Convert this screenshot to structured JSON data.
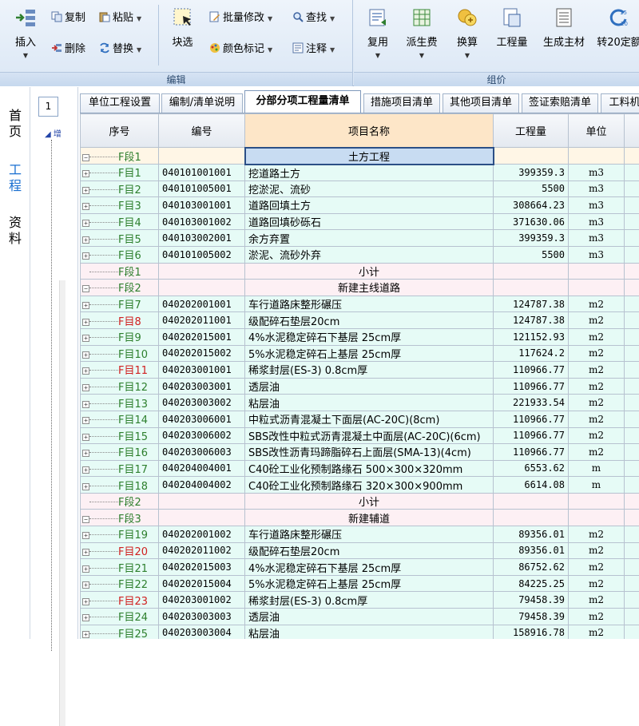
{
  "ribbon": {
    "edit_group": {
      "caption": "编辑",
      "insert": "插入",
      "copy": "复制",
      "paste": "粘贴",
      "delete": "删除",
      "replace": "替换",
      "block_select": "块选",
      "batch_edit": "批量修改",
      "find": "查找",
      "color_mark": "颜色标记",
      "comment": "注释"
    },
    "price_group": {
      "caption": "组价",
      "reuse": "复用",
      "derive_fee": "派生费",
      "convert": "换算",
      "quantity": "工程量",
      "gen_material": "生成主材",
      "to_20": "转20定额"
    }
  },
  "leftnav": {
    "items": [
      "首页",
      "工程",
      "资料"
    ],
    "active": "工程"
  },
  "tree": {
    "page_box": "1",
    "top_label": "增"
  },
  "tabs": [
    {
      "label": "单位工程设置",
      "active": false
    },
    {
      "label": "编制/清单说明",
      "active": false
    },
    {
      "label": "分部分项工程量清单",
      "active": true
    },
    {
      "label": "措施项目清单",
      "active": false
    },
    {
      "label": "其他项目清单",
      "active": false
    },
    {
      "label": "签证索赔清单",
      "active": false
    },
    {
      "label": "工料机",
      "active": false
    }
  ],
  "grid": {
    "headers": {
      "seq": "序号",
      "code": "编号",
      "name": "项目名称",
      "qty": "工程量",
      "unit": "单位"
    },
    "rows": [
      {
        "type": "section",
        "seq": "F段1",
        "code": "",
        "name": "土方工程",
        "qty": "",
        "unit": ""
      },
      {
        "type": "item",
        "seq": "F目1",
        "code": "040101001001",
        "name": "挖道路土方",
        "qty": "399359.3",
        "unit": "m3"
      },
      {
        "type": "item",
        "seq": "F目2",
        "code": "040101005001",
        "name": "挖淤泥、流砂",
        "qty": "5500",
        "unit": "m3"
      },
      {
        "type": "item",
        "seq": "F目3",
        "code": "040103001001",
        "name": "道路回填土方",
        "qty": "308664.23",
        "unit": "m3"
      },
      {
        "type": "item",
        "seq": "F目4",
        "code": "040103001002",
        "name": "道路回填砂砾石",
        "qty": "371630.06",
        "unit": "m3"
      },
      {
        "type": "item",
        "seq": "F目5",
        "code": "040103002001",
        "name": "余方弃置",
        "qty": "399359.3",
        "unit": "m3"
      },
      {
        "type": "item",
        "seq": "F目6",
        "code": "040101005002",
        "name": "淤泥、流砂外弃",
        "qty": "5500",
        "unit": "m3"
      },
      {
        "type": "subtotal",
        "seq": "F段1",
        "code": "",
        "name": "小计",
        "qty": "",
        "unit": ""
      },
      {
        "type": "section",
        "seq": "F段2",
        "code": "",
        "name": "新建主线道路",
        "qty": "",
        "unit": ""
      },
      {
        "type": "item",
        "seq": "F目7",
        "code": "040202001001",
        "name": "车行道路床整形碾压",
        "qty": "124787.38",
        "unit": "m2"
      },
      {
        "type": "item",
        "seq": "F目8",
        "code": "040202011001",
        "name": "级配碎石垫层20cm",
        "qty": "124787.38",
        "unit": "m2",
        "red": true
      },
      {
        "type": "item",
        "seq": "F目9",
        "code": "040202015001",
        "name": "4%水泥稳定碎石下基层 25cm厚",
        "qty": "121152.93",
        "unit": "m2"
      },
      {
        "type": "item",
        "seq": "F目10",
        "code": "040202015002",
        "name": "5%水泥稳定碎石上基层 25cm厚",
        "qty": "117624.2",
        "unit": "m2"
      },
      {
        "type": "item",
        "seq": "F目11",
        "code": "040203001001",
        "name": "稀浆封层(ES-3) 0.8cm厚",
        "qty": "110966.77",
        "unit": "m2",
        "red": true
      },
      {
        "type": "item",
        "seq": "F目12",
        "code": "040203003001",
        "name": "透层油",
        "qty": "110966.77",
        "unit": "m2"
      },
      {
        "type": "item",
        "seq": "F目13",
        "code": "040203003002",
        "name": "粘层油",
        "qty": "221933.54",
        "unit": "m2"
      },
      {
        "type": "item",
        "seq": "F目14",
        "code": "040203006001",
        "name": "中粒式沥青混凝土下面层(AC-20C)(8cm)",
        "qty": "110966.77",
        "unit": "m2"
      },
      {
        "type": "item",
        "seq": "F目15",
        "code": "040203006002",
        "name": "SBS改性中粒式沥青混凝土中面层(AC-20C)(6cm)",
        "qty": "110966.77",
        "unit": "m2"
      },
      {
        "type": "item",
        "seq": "F目16",
        "code": "040203006003",
        "name": "SBS改性沥青玛蹄脂碎石上面层(SMA-13)(4cm)",
        "qty": "110966.77",
        "unit": "m2"
      },
      {
        "type": "item",
        "seq": "F目17",
        "code": "040204004001",
        "name": "C40砼工业化预制路缘石 500×300×320mm",
        "qty": "6553.62",
        "unit": "m"
      },
      {
        "type": "item",
        "seq": "F目18",
        "code": "040204004002",
        "name": "C40砼工业化预制路缘石 320×300×900mm",
        "qty": "6614.08",
        "unit": "m"
      },
      {
        "type": "subtotal",
        "seq": "F段2",
        "code": "",
        "name": "小计",
        "qty": "",
        "unit": ""
      },
      {
        "type": "section",
        "seq": "F段3",
        "code": "",
        "name": "新建辅道",
        "qty": "",
        "unit": ""
      },
      {
        "type": "item",
        "seq": "F目19",
        "code": "040202001002",
        "name": "车行道路床整形碾压",
        "qty": "89356.01",
        "unit": "m2"
      },
      {
        "type": "item",
        "seq": "F目20",
        "code": "040202011002",
        "name": "级配碎石垫层20cm",
        "qty": "89356.01",
        "unit": "m2",
        "red": true
      },
      {
        "type": "item",
        "seq": "F目21",
        "code": "040202015003",
        "name": "4%水泥稳定碎石下基层 25cm厚",
        "qty": "86752.62",
        "unit": "m2"
      },
      {
        "type": "item",
        "seq": "F目22",
        "code": "040202015004",
        "name": "5%水泥稳定碎石上基层 25cm厚",
        "qty": "84225.25",
        "unit": "m2"
      },
      {
        "type": "item",
        "seq": "F目23",
        "code": "040203001002",
        "name": "稀浆封层(ES-3) 0.8cm厚",
        "qty": "79458.39",
        "unit": "m2",
        "red": true
      },
      {
        "type": "item",
        "seq": "F目24",
        "code": "040203003003",
        "name": "透层油",
        "qty": "79458.39",
        "unit": "m2"
      },
      {
        "type": "item",
        "seq": "F目25",
        "code": "040203003004",
        "name": "粘层油",
        "qty": "158916.78",
        "unit": "m2"
      }
    ]
  },
  "colors": {
    "item_row_bg": "#e6fbf6",
    "section_row_bg": "#fdf0f4",
    "name_header_bg": "#fde6c8",
    "seq_green": "#2d7f2d",
    "seq_red": "#d02020",
    "active_nav": "#1a6fd0"
  }
}
